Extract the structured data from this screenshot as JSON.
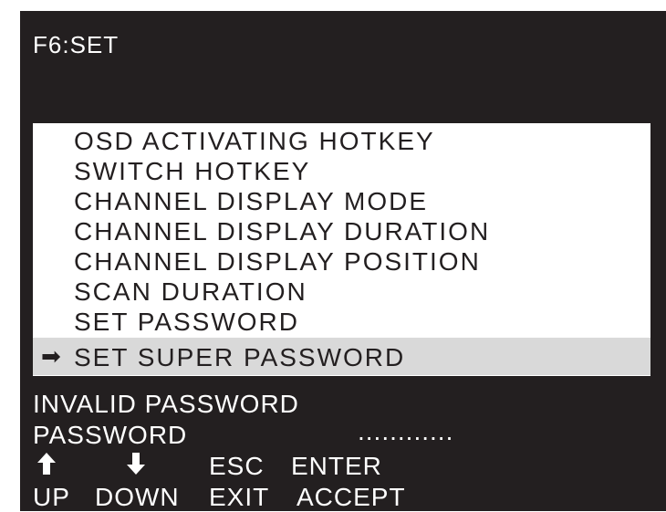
{
  "header": {
    "title": "F6:SET"
  },
  "menu": {
    "items": [
      {
        "label": "OSD ACTIVATING HOTKEY"
      },
      {
        "label": "SWITCH HOTKEY"
      },
      {
        "label": "CHANNEL  DISPLAY MODE"
      },
      {
        "label": "CHANNEL  DISPLAY DURATION"
      },
      {
        "label": "CHANNEL  DISPLAY POSITION"
      },
      {
        "label": "SCAN DURATION"
      },
      {
        "label": "SET PASSWORD"
      },
      {
        "label": "SET SUPER PASSWORD"
      }
    ],
    "selected_index": 7,
    "pointer_icon": "right-arrow-icon"
  },
  "status": {
    "message": "INVALID PASSWORD",
    "password_label": "PASSWORD",
    "password_value": "............"
  },
  "keys": {
    "up": {
      "icon": "up-arrow-icon",
      "label": "UP"
    },
    "down": {
      "icon": "down-arrow-icon",
      "label": "DOWN"
    },
    "esc": {
      "key": "ESC",
      "label": "EXIT"
    },
    "enter": {
      "key": "ENTER",
      "label": "ACCEPT"
    }
  },
  "colors": {
    "background": "#231f20",
    "menu_bg": "#ffffff",
    "selected_bg": "#d9d9d9",
    "text": "#ffffff"
  }
}
